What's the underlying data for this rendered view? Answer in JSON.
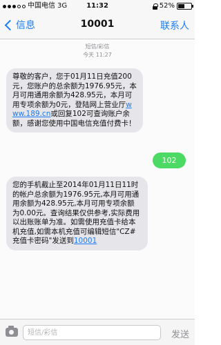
{
  "status_bar": {
    "carrier": "中国电信",
    "network": "3G",
    "time": "11:32",
    "battery_percent": "52%",
    "battery_level": 0.52
  },
  "nav": {
    "back_label": "信息",
    "title": "10001",
    "contact_label": "联系人"
  },
  "thread": {
    "meta_type": "短信/彩信",
    "meta_time": "今天 11:27"
  },
  "messages": {
    "m1_pre": "尊敬的客户，您于01月11日充值200元，您账户的总余额为1976.95元，本月可用通用余额为428.95元，本月可用专项余额为0元，登陆网上营业厅",
    "m1_link": "www.189.cn",
    "m1_post": "或回复102可查询账户余额，感谢您使用中国电信充值付费卡！",
    "m2_text": "102",
    "m3_pre": "您的手机截止至2014年01月11日11时的帐户总余额为1976.95元,本月可用通用余额为428.95元,本月可用专项余额为0.00元。查询结果仅供参考,实际费用以出账账单为准。如需使用充值卡给本机充值,如需本机充值可编辑短信\"CZ#充值卡密码\"发送到",
    "m3_link": "10001"
  },
  "input_bar": {
    "placeholder": "短信/彩信",
    "send_label": "发送"
  },
  "colors": {
    "accent": "#1a7cf5",
    "incoming_bubble": "#e5e5ea",
    "outgoing_bubble": "#4cd964"
  }
}
